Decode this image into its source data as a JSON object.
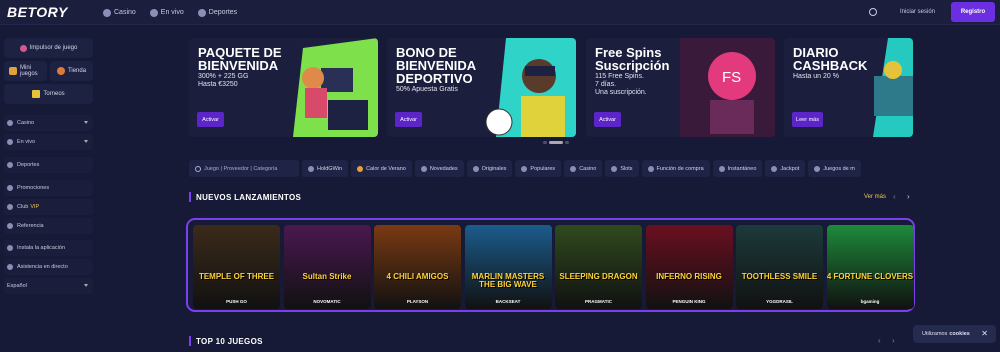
{
  "header": {
    "logo": "BETORY",
    "nav": [
      {
        "label": "Casino",
        "icon": "chip-icon"
      },
      {
        "label": "En vivo",
        "icon": "live-icon"
      },
      {
        "label": "Deportes",
        "icon": "ball-icon"
      }
    ],
    "login": "Iniciar sesión",
    "register": "Registro"
  },
  "sidebar": {
    "booster": "Impulsor de juego",
    "mini": "Mini juegos",
    "shop": "Tienda",
    "tournaments": "Torneos",
    "items": [
      {
        "label": "Casino",
        "caret": true
      },
      {
        "label": "En vivo",
        "caret": true
      },
      {
        "label": "Deportes"
      },
      {
        "label": "Promociones"
      },
      {
        "label": "Club",
        "extra": "VIP"
      },
      {
        "label": "Referencia"
      },
      {
        "label": "Instala la aplicación"
      },
      {
        "label": "Asistencia en directo"
      }
    ],
    "language": "Español"
  },
  "banners": [
    {
      "title": "PAQUETE DE BIENVENIDA",
      "sub": [
        "300% + 225 GG",
        "Hasta €3250"
      ],
      "button": "Activar",
      "color": "#7ee04a"
    },
    {
      "title": "BONO DE BIENVENIDA DEPORTIVO",
      "sub": [
        "50% Apuesta Gratis"
      ],
      "button": "Activar",
      "color": "#2fd3c7"
    },
    {
      "title": "Free Spins Suscripción",
      "sub": [
        "115 Free Spins.",
        "7 días.",
        "Una suscripción."
      ],
      "button": "Activar",
      "color": "#e23a7d"
    },
    {
      "title": "DIARIO CASHBACK",
      "sub": [
        "Hasta un 20 %"
      ],
      "button": "Leer más",
      "color": "#25c9c0"
    }
  ],
  "filters": {
    "placeholder": "Juego | Proveedor | Categoría",
    "chips": [
      "HoldGWin",
      "Calor de Verano",
      "Novedades",
      "Originales",
      "Populares",
      "Casino",
      "Slots",
      "Función de compra",
      "Instantáneo",
      "Jackpot",
      "Juegos de m"
    ]
  },
  "sections": {
    "new": "NUEVOS LANZAMIENTOS",
    "more": "Ver más",
    "top": "TOP 10 JUEGOS"
  },
  "games": [
    {
      "name": "TEMPLE OF THREE",
      "provider": "PUSH GO",
      "bg": "#3b2a1a"
    },
    {
      "name": "Sultan Strike",
      "provider": "NOVOMATIC",
      "bg": "#4a1850"
    },
    {
      "name": "4 CHILI AMIGOS",
      "provider": "PLAYSON",
      "bg": "#7a3a12"
    },
    {
      "name": "MARLIN MASTERS THE BIG WAVE",
      "provider": "BACKSEAT",
      "bg": "#1b5c8c"
    },
    {
      "name": "SLEEPING DRAGON",
      "provider": "PRAGMATIC",
      "bg": "#2f4a1e"
    },
    {
      "name": "INFERNO RISING",
      "provider": "PENGUIN KING",
      "bg": "#6a1020"
    },
    {
      "name": "TOOTHLESS SMILE",
      "provider": "YGGDRASIL",
      "bg": "#1d3a3a"
    },
    {
      "name": "4 FORTUNE CLOVERS",
      "provider": "bgaming",
      "bg": "#1d8a3a"
    }
  ],
  "cookie": {
    "text": "Utilizamos",
    "bold": "cookies"
  }
}
